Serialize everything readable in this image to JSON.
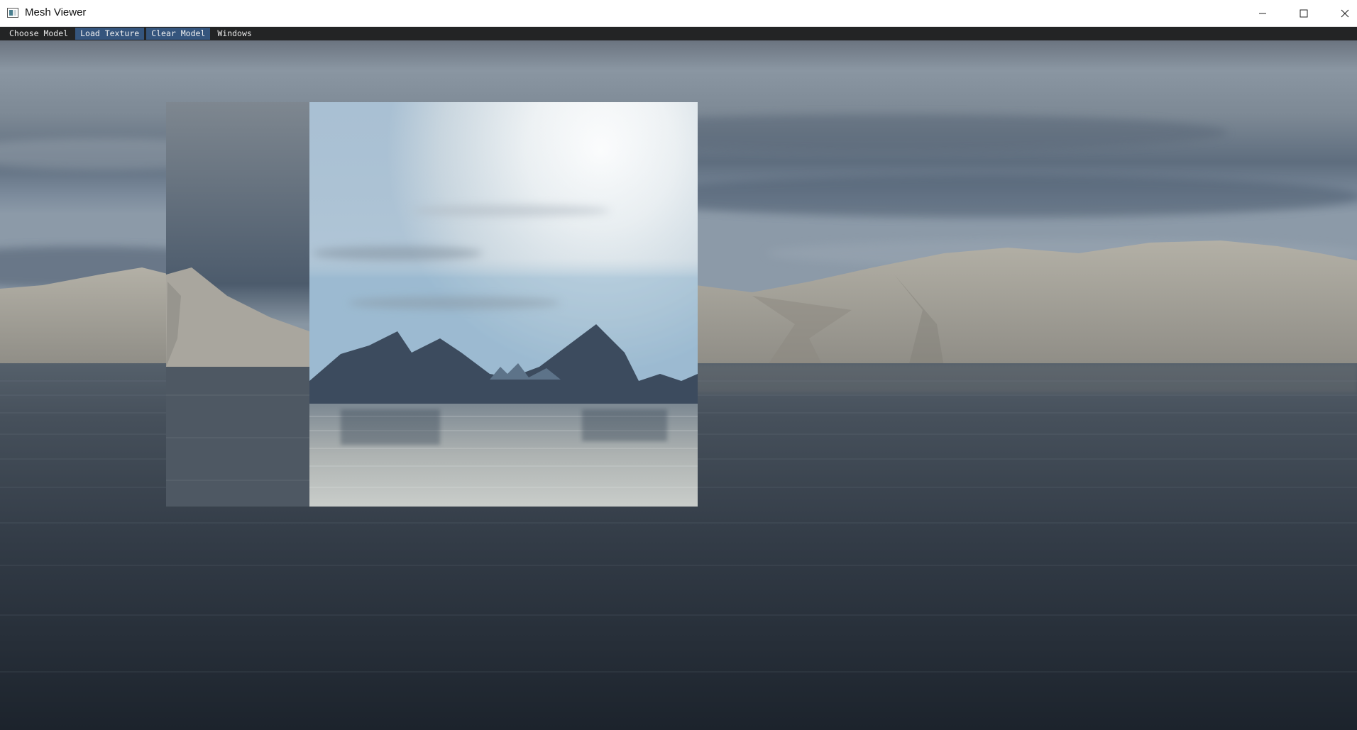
{
  "window": {
    "title": "Mesh Viewer",
    "icon": "app-window-icon",
    "controls": [
      "minimize-icon",
      "maximize-icon",
      "close-icon"
    ]
  },
  "menubar": {
    "items": [
      {
        "label": "Choose Model",
        "active": false
      },
      {
        "label": "Load Texture",
        "active": true
      },
      {
        "label": "Clear Model",
        "active": true
      },
      {
        "label": "Windows",
        "active": false
      }
    ]
  },
  "viewport": {
    "scene": "skybox-lake-mountains",
    "colors": {
      "sky_top": "#8593a1",
      "sky_band": "#5d6c7d",
      "mountains": "#a8a59c",
      "water_far": "#4c5661",
      "water_near": "#1f2731",
      "menu_active": "#35557d",
      "menu_bg": "#232425"
    }
  }
}
